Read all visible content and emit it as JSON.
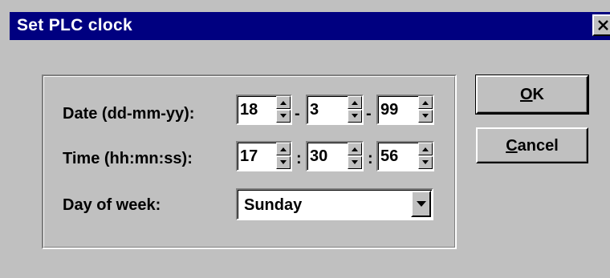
{
  "window": {
    "title": "Set PLC clock",
    "close_glyph": "✕"
  },
  "date": {
    "label": "Date (dd-mm-yy):",
    "day": "18",
    "month": "3",
    "year": "99",
    "separator": "-"
  },
  "time": {
    "label": "Time (hh:mn:ss):",
    "hours": "17",
    "minutes": "30",
    "seconds": "56",
    "separator": ":"
  },
  "day_of_week": {
    "label": "Day of week:",
    "selected": "Sunday"
  },
  "buttons": {
    "ok_mnemonic": "O",
    "ok_rest": "K",
    "cancel_mnemonic": "C",
    "cancel_rest": "ancel"
  },
  "colors": {
    "titlebar": "#000080",
    "face": "#c0c0c0"
  }
}
